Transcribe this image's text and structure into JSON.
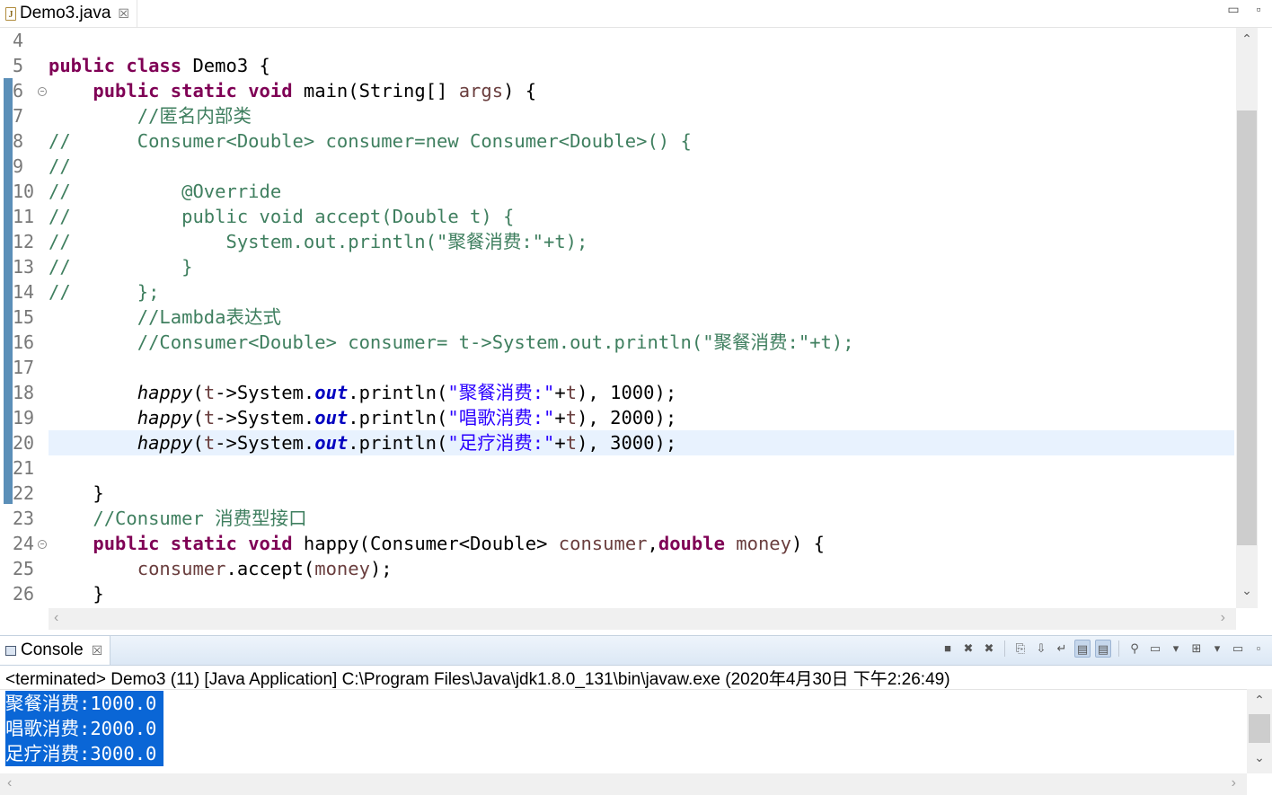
{
  "editor_tab": {
    "title": "Demo3.java",
    "close": "☒"
  },
  "window_controls": {
    "minimize": "▭",
    "maximize": "▫"
  },
  "code_lines": [
    {
      "num": "4",
      "tokens": []
    },
    {
      "num": "5",
      "tokens": [
        [
          "kw",
          "public"
        ],
        [
          "t",
          " "
        ],
        [
          "kw",
          "class"
        ],
        [
          "t",
          " Demo3 {"
        ]
      ]
    },
    {
      "num": "6",
      "fold": true,
      "tokens": [
        [
          "t",
          "    "
        ],
        [
          "kw",
          "public"
        ],
        [
          "t",
          " "
        ],
        [
          "kw",
          "static"
        ],
        [
          "t",
          " "
        ],
        [
          "kw",
          "void"
        ],
        [
          "t",
          " main(String[] "
        ],
        [
          "var",
          "args"
        ],
        [
          "t",
          ") {"
        ]
      ]
    },
    {
      "num": "7",
      "tokens": [
        [
          "t",
          "        "
        ],
        [
          "cm",
          "//匿名内部类"
        ]
      ]
    },
    {
      "num": "8",
      "tokens": [
        [
          "cm",
          "//      Consumer<Double> consumer=new Consumer<Double>() {"
        ]
      ]
    },
    {
      "num": "9",
      "tokens": [
        [
          "cm",
          "//"
        ]
      ]
    },
    {
      "num": "10",
      "tokens": [
        [
          "cm",
          "//          @Override"
        ]
      ]
    },
    {
      "num": "11",
      "tokens": [
        [
          "cm",
          "//          public void accept(Double t) {"
        ]
      ]
    },
    {
      "num": "12",
      "tokens": [
        [
          "cm",
          "//              System.out.println(\"聚餐消费:\"+t);"
        ]
      ]
    },
    {
      "num": "13",
      "tokens": [
        [
          "cm",
          "//          }"
        ]
      ]
    },
    {
      "num": "14",
      "tokens": [
        [
          "cm",
          "//      };"
        ]
      ]
    },
    {
      "num": "15",
      "tokens": [
        [
          "t",
          "        "
        ],
        [
          "cm",
          "//Lambda表达式"
        ]
      ]
    },
    {
      "num": "16",
      "tokens": [
        [
          "t",
          "        "
        ],
        [
          "cm",
          "//Consumer<Double> consumer= t->System.out.println(\"聚餐消费:\"+t);"
        ]
      ]
    },
    {
      "num": "17",
      "tokens": []
    },
    {
      "num": "18",
      "tokens": [
        [
          "t",
          "        "
        ],
        [
          "ital",
          "happy"
        ],
        [
          "t",
          "("
        ],
        [
          "var",
          "t"
        ],
        [
          "t",
          "->System."
        ],
        [
          "fld",
          "out"
        ],
        [
          "t",
          ".println("
        ],
        [
          "str",
          "\"聚餐消费:\""
        ],
        [
          "t",
          "+"
        ],
        [
          "var",
          "t"
        ],
        [
          "t",
          "), 1000);"
        ]
      ]
    },
    {
      "num": "19",
      "tokens": [
        [
          "t",
          "        "
        ],
        [
          "ital",
          "happy"
        ],
        [
          "t",
          "("
        ],
        [
          "var",
          "t"
        ],
        [
          "t",
          "->System."
        ],
        [
          "fld",
          "out"
        ],
        [
          "t",
          ".println("
        ],
        [
          "str",
          "\"唱歌消费:\""
        ],
        [
          "t",
          "+"
        ],
        [
          "var",
          "t"
        ],
        [
          "t",
          "), 2000);"
        ]
      ]
    },
    {
      "num": "20",
      "current": true,
      "tokens": [
        [
          "t",
          "        "
        ],
        [
          "ital",
          "happy"
        ],
        [
          "t",
          "("
        ],
        [
          "var",
          "t"
        ],
        [
          "t",
          "->System."
        ],
        [
          "fld",
          "out"
        ],
        [
          "t",
          ".println("
        ],
        [
          "str",
          "\"足疗消费:\""
        ],
        [
          "t",
          "+"
        ],
        [
          "var",
          "t"
        ],
        [
          "t",
          "), 3000);"
        ]
      ]
    },
    {
      "num": "21",
      "tokens": []
    },
    {
      "num": "22",
      "tokens": [
        [
          "t",
          "    }"
        ]
      ]
    },
    {
      "num": "23",
      "tokens": [
        [
          "t",
          "    "
        ],
        [
          "cm",
          "//Consumer 消费型接口"
        ]
      ]
    },
    {
      "num": "24",
      "fold": true,
      "tokens": [
        [
          "t",
          "    "
        ],
        [
          "kw",
          "public"
        ],
        [
          "t",
          " "
        ],
        [
          "kw",
          "static"
        ],
        [
          "t",
          " "
        ],
        [
          "kw",
          "void"
        ],
        [
          "t",
          " happy(Consumer<Double> "
        ],
        [
          "var",
          "consumer"
        ],
        [
          "t",
          ","
        ],
        [
          "kw",
          "double"
        ],
        [
          "t",
          " "
        ],
        [
          "var",
          "money"
        ],
        [
          "t",
          ") {"
        ]
      ]
    },
    {
      "num": "25",
      "tokens": [
        [
          "t",
          "        "
        ],
        [
          "var",
          "consumer"
        ],
        [
          "t",
          ".accept("
        ],
        [
          "var",
          "money"
        ],
        [
          "t",
          ");"
        ]
      ]
    },
    {
      "num": "26",
      "tokens": [
        [
          "t",
          "    }"
        ]
      ]
    }
  ],
  "console": {
    "tab_title": "Console",
    "close": "☒",
    "status": "<terminated> Demo3 (11) [Java Application] C:\\Program Files\\Java\\jdk1.8.0_131\\bin\\javaw.exe (2020年4月30日 下午2:26:49)",
    "output_lines": [
      "聚餐消费:1000.0",
      "唱歌消费:2000.0",
      "足疗消费:3000.0"
    ],
    "toolbar": [
      {
        "name": "terminate-icon",
        "glyph": "■",
        "on": false
      },
      {
        "name": "remove-launch-icon",
        "glyph": "✖",
        "on": false
      },
      {
        "name": "remove-all-terminated-icon",
        "glyph": "✖",
        "on": false
      },
      {
        "sep": true
      },
      {
        "name": "clear-console-icon",
        "glyph": "⎘",
        "on": false
      },
      {
        "name": "scroll-lock-icon",
        "glyph": "⇩",
        "on": false
      },
      {
        "name": "word-wrap-icon",
        "glyph": "↵",
        "on": false
      },
      {
        "name": "show-on-stdout-icon",
        "glyph": "▤",
        "on": true
      },
      {
        "name": "show-on-stderr-icon",
        "glyph": "▤",
        "on": true
      },
      {
        "sep": true
      },
      {
        "name": "pin-console-icon",
        "glyph": "⚲",
        "on": false
      },
      {
        "name": "display-console-icon",
        "glyph": "▭",
        "on": false
      },
      {
        "name": "display-console-dropdown-icon",
        "glyph": "▾",
        "on": false
      },
      {
        "name": "open-console-icon",
        "glyph": "⊞",
        "on": false
      },
      {
        "name": "open-console-dropdown-icon",
        "glyph": "▾",
        "on": false
      },
      {
        "name": "minimize-view-icon",
        "glyph": "▭",
        "on": false
      },
      {
        "name": "maximize-view-icon",
        "glyph": "▫",
        "on": false
      }
    ]
  },
  "scroll_arrows": {
    "up": "⌃",
    "down": "⌄",
    "left": "‹",
    "right": "›"
  }
}
